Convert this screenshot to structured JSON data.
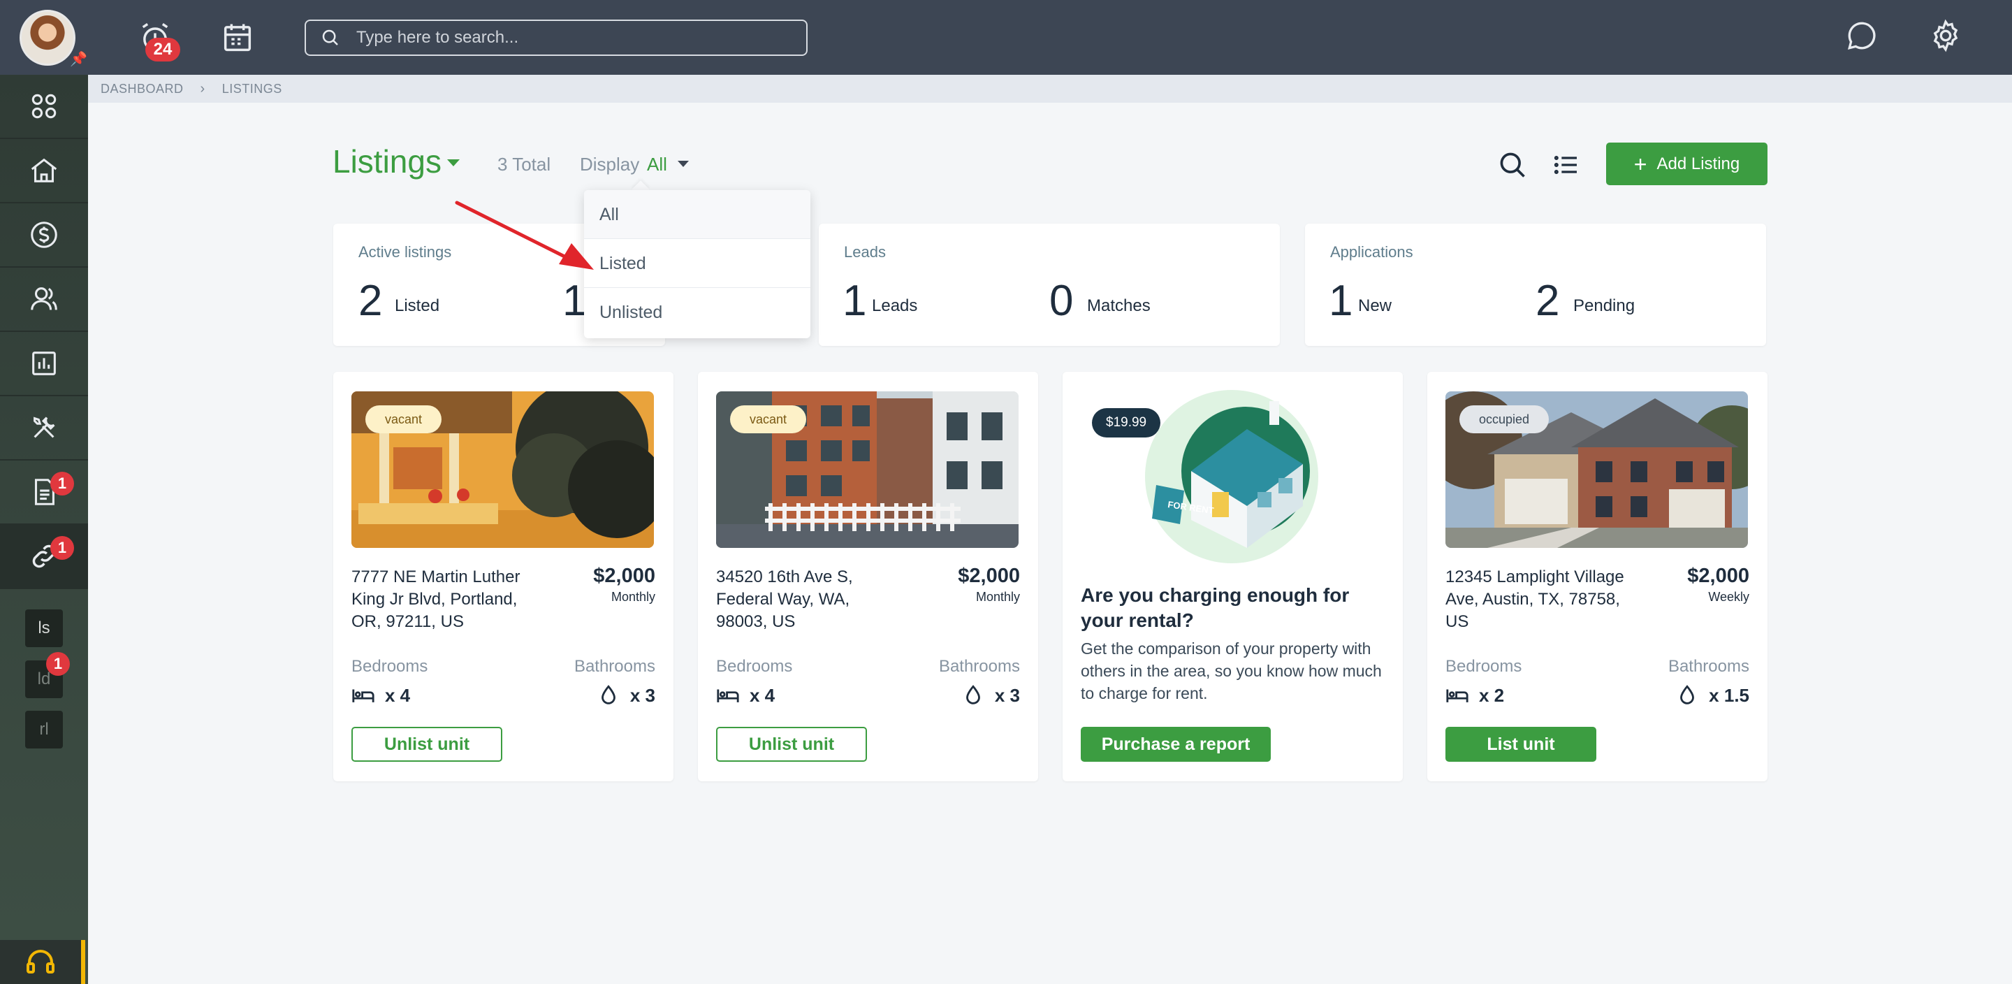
{
  "topbar": {
    "notifications_count": "24",
    "search_placeholder": "Type here to search..."
  },
  "sidebar": {
    "items": [
      {
        "icon": "apps-grid-icon"
      },
      {
        "icon": "home-icon"
      },
      {
        "icon": "dollar-icon"
      },
      {
        "icon": "users-icon"
      },
      {
        "icon": "chart-icon"
      },
      {
        "icon": "tools-icon"
      },
      {
        "icon": "document-icon",
        "badge": "1"
      },
      {
        "icon": "link-icon",
        "badge": "1"
      }
    ],
    "shortcuts": [
      {
        "label": "ls"
      },
      {
        "label": "ld",
        "badge": "1"
      },
      {
        "label": "rl"
      }
    ]
  },
  "breadcrumb": {
    "root": "DASHBOARD",
    "current": "LISTINGS"
  },
  "header": {
    "title": "Listings",
    "total": "3 Total",
    "display_label": "Display",
    "display_value": "All",
    "add_button": "Add Listing"
  },
  "display_dropdown": {
    "options": [
      "All",
      "Listed",
      "Unlisted"
    ]
  },
  "stats": {
    "active": {
      "title": "Active listings",
      "num1": "2",
      "label1": "Listed",
      "num2": "1"
    },
    "leads": {
      "title": "Leads",
      "num1": "1",
      "label1": "Leads",
      "num2": "0",
      "label2": "Matches"
    },
    "applications": {
      "title": "Applications",
      "num1": "1",
      "label1": "New",
      "num2": "2",
      "label2": "Pending"
    }
  },
  "listings": [
    {
      "status": "vacant",
      "address": "7777 NE Martin Luther King Jr Blvd, Portland, OR, 97211, US",
      "price": "$2,000",
      "period": "Monthly",
      "bedrooms_label": "Bedrooms",
      "bedrooms": "x 4",
      "bathrooms_label": "Bathrooms",
      "bathrooms": "x 3",
      "action": "Unlist unit"
    },
    {
      "status": "vacant",
      "address": "34520 16th Ave S, Federal Way, WA, 98003, US",
      "price": "$2,000",
      "period": "Monthly",
      "bedrooms_label": "Bedrooms",
      "bedrooms": "x 4",
      "bathrooms_label": "Bathrooms",
      "bathrooms": "x 3",
      "action": "Unlist unit"
    },
    {
      "status": "occupied",
      "address": "12345 Lamplight Village Ave, Austin, TX, 78758, US",
      "price": "$2,000",
      "period": "Weekly",
      "bedrooms_label": "Bedrooms",
      "bedrooms": "x 2",
      "bathrooms_label": "Bathrooms",
      "bathrooms": "x 1.5",
      "action": "List unit"
    }
  ],
  "promo": {
    "price": "$19.99",
    "sign_text": "FOR RENT",
    "heading": "Are you charging enough for your rental?",
    "body": "Get the comparison of your property with others in the area, so you know how much to charge for rent.",
    "button": "Purchase a report"
  },
  "colors": {
    "accent": "#3c9d41",
    "topbar": "#3d4654",
    "badge": "#e0383e",
    "annotation_arrow": "#e0252b"
  }
}
